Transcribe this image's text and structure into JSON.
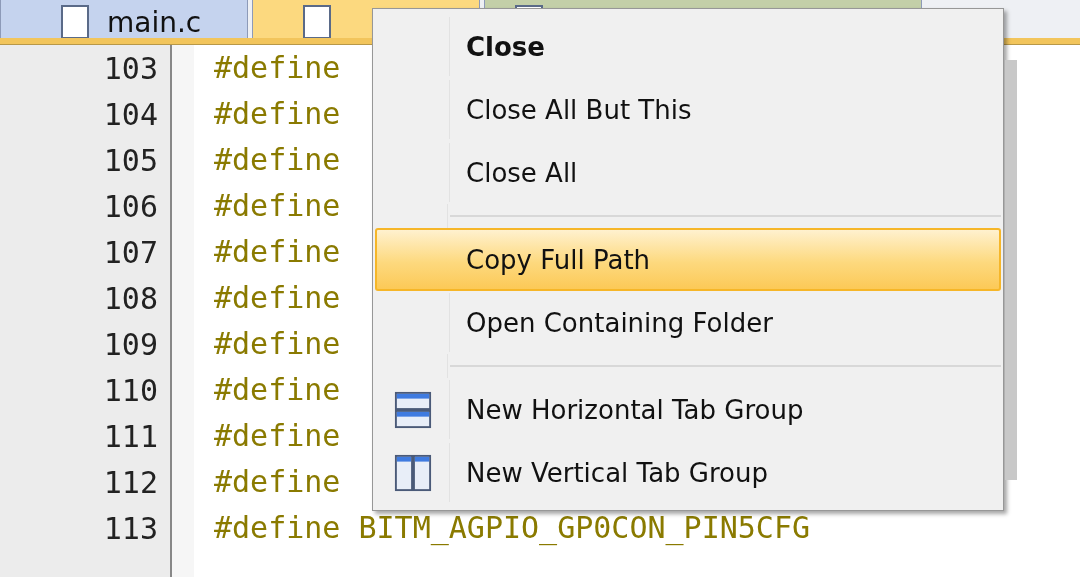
{
  "tabs": [
    {
      "label": "main.c",
      "selected": false
    },
    {
      "selected": true
    },
    {
      "selected": false
    }
  ],
  "code": {
    "lines": [
      {
        "number": "103",
        "text": "#define"
      },
      {
        "number": "104",
        "text": "#define"
      },
      {
        "number": "105",
        "text": "#define"
      },
      {
        "number": "106",
        "text": "#define"
      },
      {
        "number": "107",
        "text": "#define"
      },
      {
        "number": "108",
        "text": "#define"
      },
      {
        "number": "109",
        "text": "#define"
      },
      {
        "number": "110",
        "text": "#define"
      },
      {
        "number": "111",
        "text": "#define"
      },
      {
        "number": "112",
        "text": "#define"
      },
      {
        "number": "113",
        "text": "#define BITM_AGPIO_GP0CON_PIN5CFG"
      }
    ]
  },
  "context_menu": {
    "items": [
      {
        "kind": "command",
        "label": "Close",
        "default": true,
        "selected": false
      },
      {
        "kind": "command",
        "label": "Close All But This",
        "default": false,
        "selected": false
      },
      {
        "kind": "command",
        "label": "Close All",
        "default": false,
        "selected": false
      },
      {
        "kind": "separator"
      },
      {
        "kind": "command",
        "label": "Copy Full Path",
        "default": false,
        "selected": true
      },
      {
        "kind": "command",
        "label": "Open Containing Folder",
        "default": false,
        "selected": false
      },
      {
        "kind": "separator"
      },
      {
        "kind": "hsplit",
        "label": "New Horizontal Tab Group",
        "default": false,
        "selected": false
      },
      {
        "kind": "vsplit",
        "label": "New Vertical Tab Group",
        "default": false,
        "selected": false
      }
    ]
  }
}
